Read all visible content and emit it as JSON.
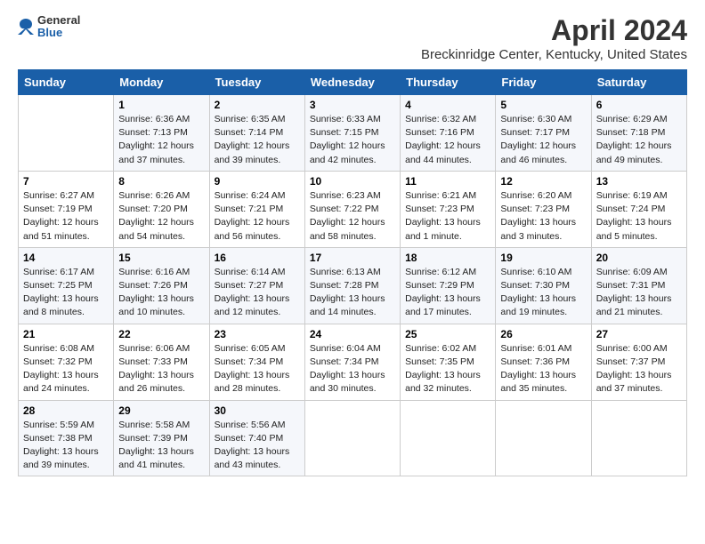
{
  "logo": {
    "general": "General",
    "blue": "Blue"
  },
  "title": "April 2024",
  "subtitle": "Breckinridge Center, Kentucky, United States",
  "days_of_week": [
    "Sunday",
    "Monday",
    "Tuesday",
    "Wednesday",
    "Thursday",
    "Friday",
    "Saturday"
  ],
  "weeks": [
    [
      {
        "date": "",
        "content": ""
      },
      {
        "date": "1",
        "content": "Sunrise: 6:36 AM\nSunset: 7:13 PM\nDaylight: 12 hours\nand 37 minutes."
      },
      {
        "date": "2",
        "content": "Sunrise: 6:35 AM\nSunset: 7:14 PM\nDaylight: 12 hours\nand 39 minutes."
      },
      {
        "date": "3",
        "content": "Sunrise: 6:33 AM\nSunset: 7:15 PM\nDaylight: 12 hours\nand 42 minutes."
      },
      {
        "date": "4",
        "content": "Sunrise: 6:32 AM\nSunset: 7:16 PM\nDaylight: 12 hours\nand 44 minutes."
      },
      {
        "date": "5",
        "content": "Sunrise: 6:30 AM\nSunset: 7:17 PM\nDaylight: 12 hours\nand 46 minutes."
      },
      {
        "date": "6",
        "content": "Sunrise: 6:29 AM\nSunset: 7:18 PM\nDaylight: 12 hours\nand 49 minutes."
      }
    ],
    [
      {
        "date": "7",
        "content": "Sunrise: 6:27 AM\nSunset: 7:19 PM\nDaylight: 12 hours\nand 51 minutes."
      },
      {
        "date": "8",
        "content": "Sunrise: 6:26 AM\nSunset: 7:20 PM\nDaylight: 12 hours\nand 54 minutes."
      },
      {
        "date": "9",
        "content": "Sunrise: 6:24 AM\nSunset: 7:21 PM\nDaylight: 12 hours\nand 56 minutes."
      },
      {
        "date": "10",
        "content": "Sunrise: 6:23 AM\nSunset: 7:22 PM\nDaylight: 12 hours\nand 58 minutes."
      },
      {
        "date": "11",
        "content": "Sunrise: 6:21 AM\nSunset: 7:23 PM\nDaylight: 13 hours\nand 1 minute."
      },
      {
        "date": "12",
        "content": "Sunrise: 6:20 AM\nSunset: 7:23 PM\nDaylight: 13 hours\nand 3 minutes."
      },
      {
        "date": "13",
        "content": "Sunrise: 6:19 AM\nSunset: 7:24 PM\nDaylight: 13 hours\nand 5 minutes."
      }
    ],
    [
      {
        "date": "14",
        "content": "Sunrise: 6:17 AM\nSunset: 7:25 PM\nDaylight: 13 hours\nand 8 minutes."
      },
      {
        "date": "15",
        "content": "Sunrise: 6:16 AM\nSunset: 7:26 PM\nDaylight: 13 hours\nand 10 minutes."
      },
      {
        "date": "16",
        "content": "Sunrise: 6:14 AM\nSunset: 7:27 PM\nDaylight: 13 hours\nand 12 minutes."
      },
      {
        "date": "17",
        "content": "Sunrise: 6:13 AM\nSunset: 7:28 PM\nDaylight: 13 hours\nand 14 minutes."
      },
      {
        "date": "18",
        "content": "Sunrise: 6:12 AM\nSunset: 7:29 PM\nDaylight: 13 hours\nand 17 minutes."
      },
      {
        "date": "19",
        "content": "Sunrise: 6:10 AM\nSunset: 7:30 PM\nDaylight: 13 hours\nand 19 minutes."
      },
      {
        "date": "20",
        "content": "Sunrise: 6:09 AM\nSunset: 7:31 PM\nDaylight: 13 hours\nand 21 minutes."
      }
    ],
    [
      {
        "date": "21",
        "content": "Sunrise: 6:08 AM\nSunset: 7:32 PM\nDaylight: 13 hours\nand 24 minutes."
      },
      {
        "date": "22",
        "content": "Sunrise: 6:06 AM\nSunset: 7:33 PM\nDaylight: 13 hours\nand 26 minutes."
      },
      {
        "date": "23",
        "content": "Sunrise: 6:05 AM\nSunset: 7:34 PM\nDaylight: 13 hours\nand 28 minutes."
      },
      {
        "date": "24",
        "content": "Sunrise: 6:04 AM\nSunset: 7:34 PM\nDaylight: 13 hours\nand 30 minutes."
      },
      {
        "date": "25",
        "content": "Sunrise: 6:02 AM\nSunset: 7:35 PM\nDaylight: 13 hours\nand 32 minutes."
      },
      {
        "date": "26",
        "content": "Sunrise: 6:01 AM\nSunset: 7:36 PM\nDaylight: 13 hours\nand 35 minutes."
      },
      {
        "date": "27",
        "content": "Sunrise: 6:00 AM\nSunset: 7:37 PM\nDaylight: 13 hours\nand 37 minutes."
      }
    ],
    [
      {
        "date": "28",
        "content": "Sunrise: 5:59 AM\nSunset: 7:38 PM\nDaylight: 13 hours\nand 39 minutes."
      },
      {
        "date": "29",
        "content": "Sunrise: 5:58 AM\nSunset: 7:39 PM\nDaylight: 13 hours\nand 41 minutes."
      },
      {
        "date": "30",
        "content": "Sunrise: 5:56 AM\nSunset: 7:40 PM\nDaylight: 13 hours\nand 43 minutes."
      },
      {
        "date": "",
        "content": ""
      },
      {
        "date": "",
        "content": ""
      },
      {
        "date": "",
        "content": ""
      },
      {
        "date": "",
        "content": ""
      }
    ]
  ]
}
